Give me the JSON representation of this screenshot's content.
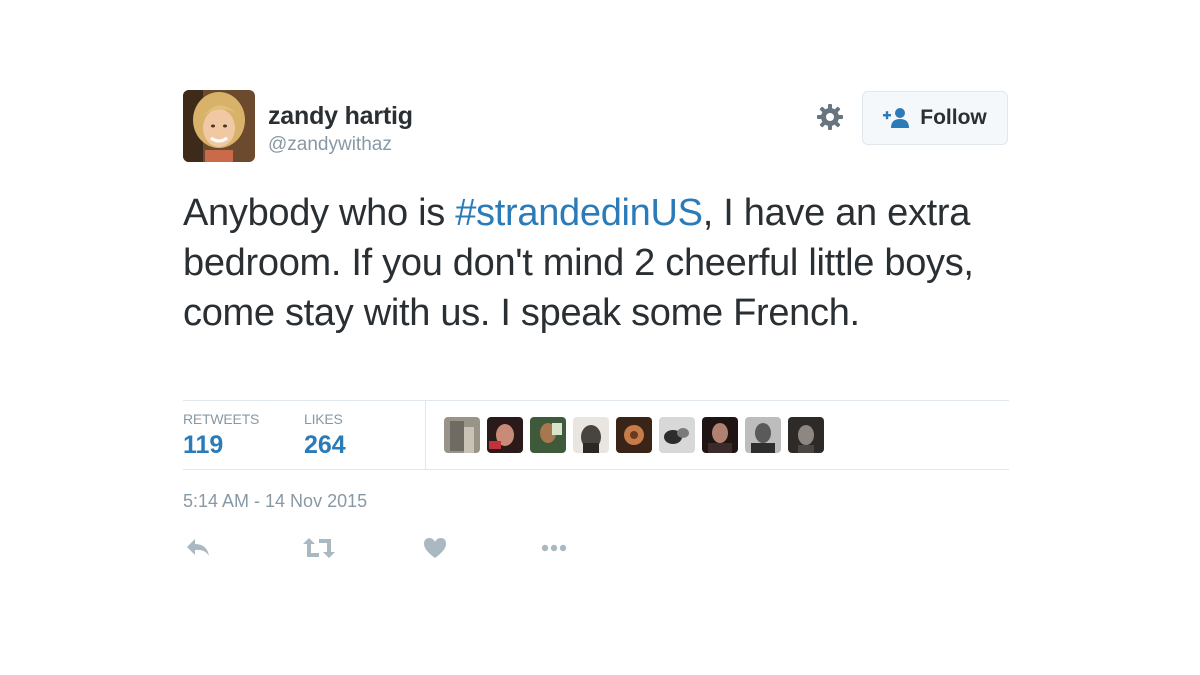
{
  "user": {
    "name": "zandy hartig",
    "handle": "@zandywithaz"
  },
  "follow_button": {
    "label": "Follow"
  },
  "tweet": {
    "text_before": "Anybody who is ",
    "hashtag": "#strandedinUS",
    "text_after": ", I have an extra bedroom. If you don't mind 2 cheerful little boys, come stay with us. I speak some French."
  },
  "stats": {
    "retweets_label": "RETWEETS",
    "retweets_count": "119",
    "likes_label": "LIKES",
    "likes_count": "264"
  },
  "timestamp": "5:14 AM - 14 Nov 2015",
  "icons": {
    "settings": "gear-icon",
    "follow": "add-person-icon",
    "reply": "reply-icon",
    "retweet": "retweet-icon",
    "like": "heart-icon",
    "more": "more-dots-icon"
  },
  "colors": {
    "link": "#2b7bb9",
    "text": "#292f33",
    "muted": "#8899a6",
    "icon": "#aab8c2",
    "border": "#e1e8ed"
  }
}
